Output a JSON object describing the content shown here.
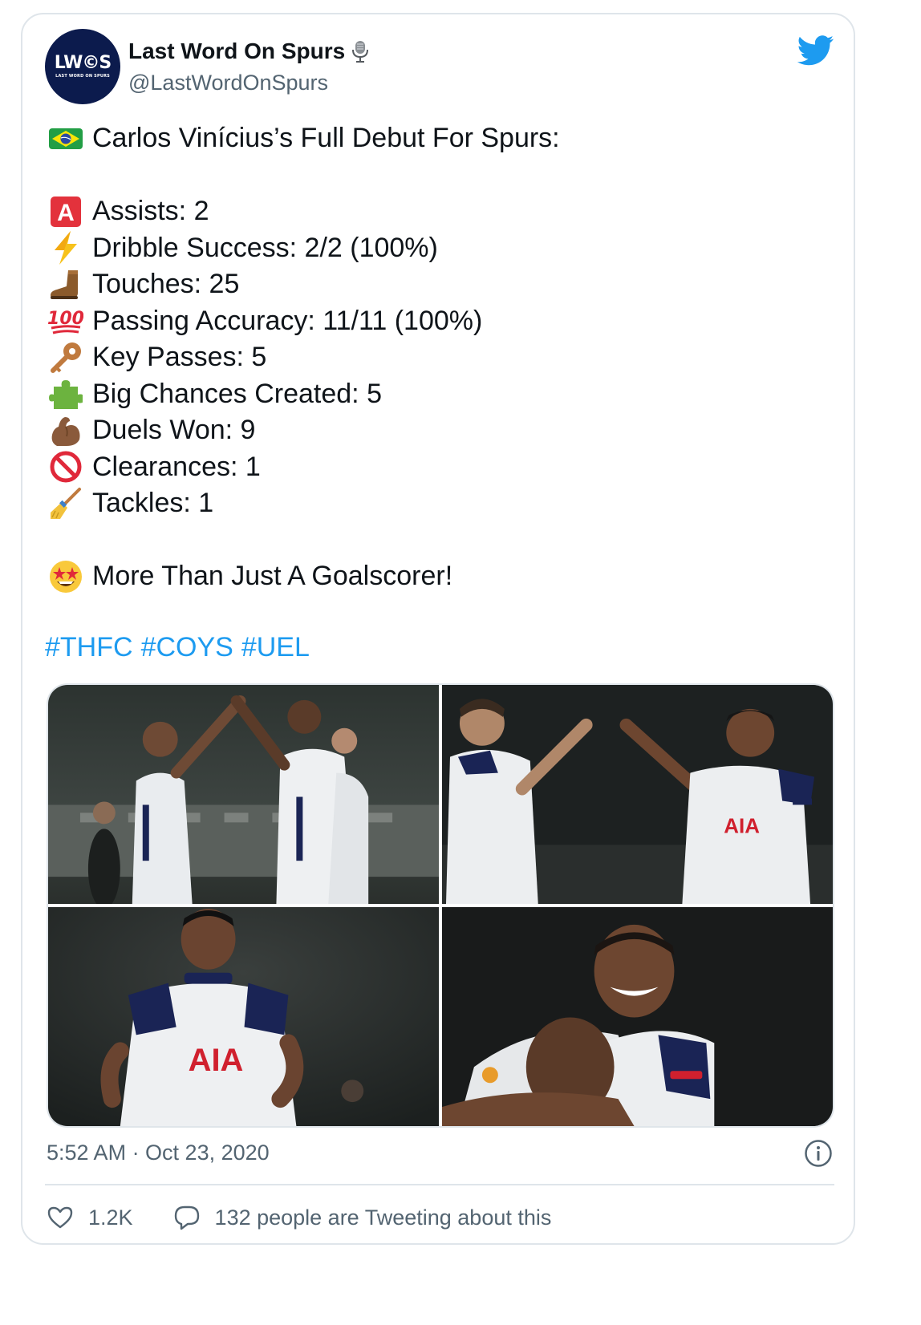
{
  "tweet": {
    "author": {
      "display_name": "Last Word On Spurs",
      "handle": "@LastWordOnSpurs",
      "avatar_text": "LW©S",
      "avatar_subtext": "LAST WORD ON SPURS"
    },
    "lines": [
      {
        "emoji": "flag-brazil-icon",
        "text": "Carlos Vinícius’s Full Debut For Spurs:"
      },
      {
        "emoji": "letter-a-icon",
        "text": "Assists: 2"
      },
      {
        "emoji": "lightning-icon",
        "text": "Dribble Success: 2/2 (100%)"
      },
      {
        "emoji": "boot-icon",
        "text": "Touches: 25"
      },
      {
        "emoji": "hundred-icon",
        "text": "Passing Accuracy: 11/11 (100%)"
      },
      {
        "emoji": "key-icon",
        "text": "Key Passes: 5"
      },
      {
        "emoji": "puzzle-icon",
        "text": "Big Chances Created: 5"
      },
      {
        "emoji": "flexed-biceps-icon",
        "text": "Duels Won: 9"
      },
      {
        "emoji": "no-entry-icon",
        "text": "Clearances: 1"
      },
      {
        "emoji": "broom-icon",
        "text": "Tackles: 1"
      },
      {
        "emoji": "star-struck-icon",
        "text": "More Than Just A Goalscorer!"
      }
    ],
    "hashtags": [
      "#THFC",
      "#COYS",
      "#UEL"
    ],
    "timestamp": "5:52 AM · Oct 23, 2020",
    "likes": "1.2K",
    "reply_text": "132 people are Tweeting about this",
    "colors": {
      "link": "#1d9bf0",
      "secondary_text": "#536471",
      "border": "#dfe5ea",
      "avatar_bg": "#0c1b4d",
      "twitter_blue": "#1d9bf0"
    }
  }
}
